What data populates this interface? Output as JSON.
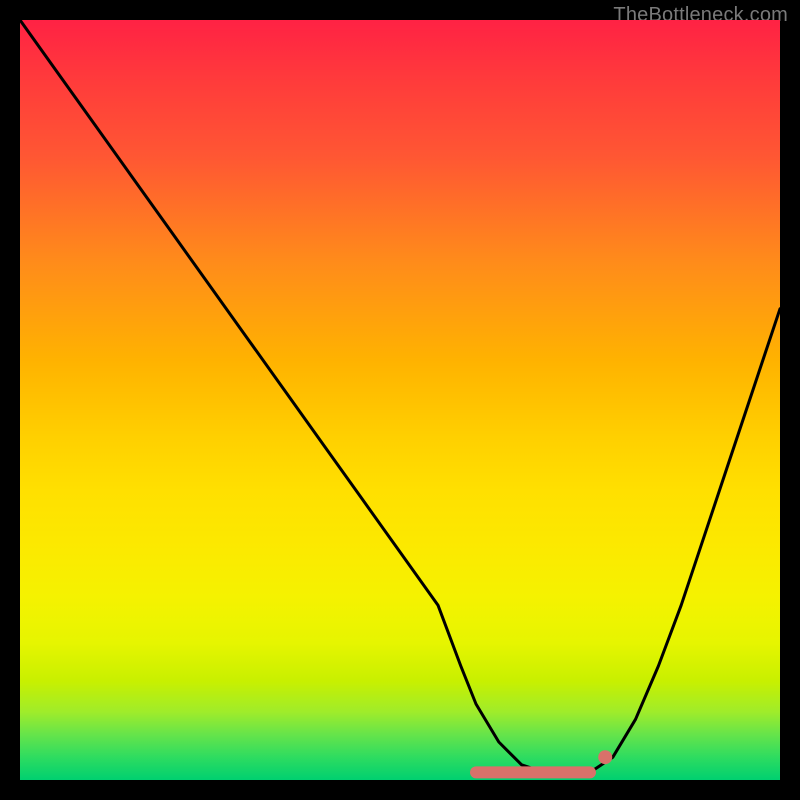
{
  "watermark": "TheBottleneck.com",
  "chart_data": {
    "type": "line",
    "title": "",
    "xlabel": "",
    "ylabel": "",
    "xlim": [
      0,
      100
    ],
    "ylim": [
      0,
      100
    ],
    "grid": false,
    "legend": false,
    "series": [
      {
        "name": "bottleneck-curve",
        "x": [
          0,
          5,
          10,
          15,
          20,
          25,
          30,
          35,
          40,
          45,
          50,
          55,
          58,
          60,
          63,
          66,
          69,
          72,
          75,
          78,
          81,
          84,
          87,
          90,
          93,
          96,
          100
        ],
        "y": [
          100,
          93,
          86,
          79,
          72,
          65,
          58,
          51,
          44,
          37,
          30,
          23,
          15,
          10,
          5,
          2,
          1,
          1,
          1,
          3,
          8,
          15,
          23,
          32,
          41,
          50,
          62
        ]
      },
      {
        "name": "highlight-band",
        "x": [
          60,
          75
        ],
        "y": [
          1,
          1
        ]
      },
      {
        "name": "highlight-dot",
        "x": [
          77
        ],
        "y": [
          3
        ]
      }
    ],
    "colors": {
      "curve": "#000000",
      "highlight": "#d9716a"
    },
    "background_gradient": [
      "#ff2244",
      "#ff5733",
      "#ffb300",
      "#ffe000",
      "#a0ec2a",
      "#00d070"
    ]
  }
}
